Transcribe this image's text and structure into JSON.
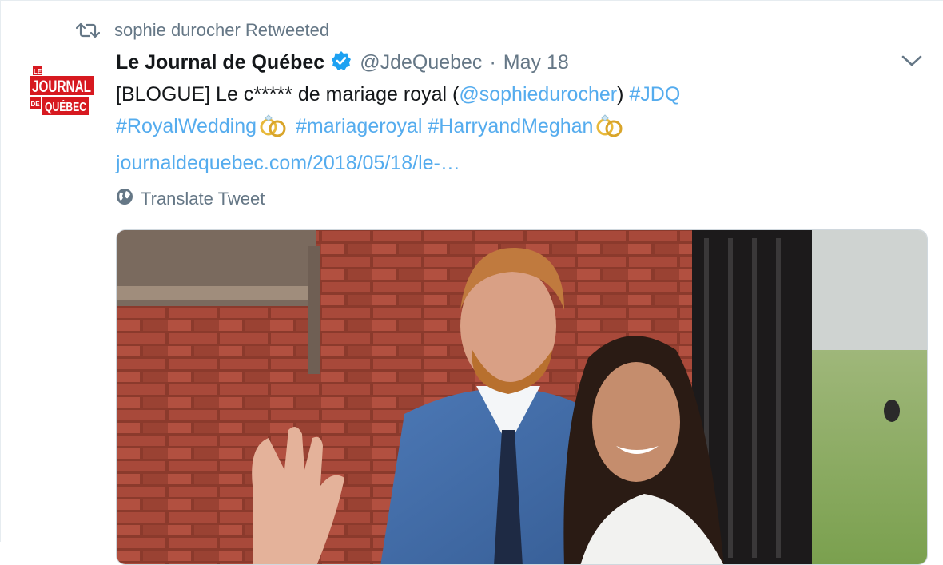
{
  "retweet_context": {
    "icon": "retweet-icon",
    "text": "sophie durocher Retweeted"
  },
  "author": {
    "avatar_logo": {
      "line1": "LE",
      "line2": "JOURNAL",
      "line3": "DE",
      "line4": "QUÉBEC"
    },
    "fullname": "Le Journal de Québec",
    "verified": true,
    "handle": "@JdeQuebec",
    "separator": "·",
    "timestamp": "May 18"
  },
  "tweet": {
    "text_prefix": "[BLOGUE] Le c***** de mariage royal (",
    "mention": "@sophiedurocher",
    "text_close": ")",
    "hashtag_jdq": "#JDQ",
    "hashtag_royalwedding": "#RoyalWedding",
    "hashtag_mariageroyal": "#mariageroyal",
    "hashtag_harryandmeghan": "#HarryandMeghan",
    "link": "journaldequebec.com/2018/05/18/le-…",
    "emoji": "rings-emoji"
  },
  "translate": {
    "icon": "globe-icon",
    "label": "Translate Tweet"
  },
  "menu": {
    "icon": "chevron-down-icon"
  },
  "media": {
    "type": "photo",
    "subject": "couple in front of brick wall"
  },
  "colors": {
    "link": "#55acee",
    "secondary": "#657786",
    "text": "#14171a",
    "verified": "#1da1f2",
    "brand_red": "#d71920"
  }
}
